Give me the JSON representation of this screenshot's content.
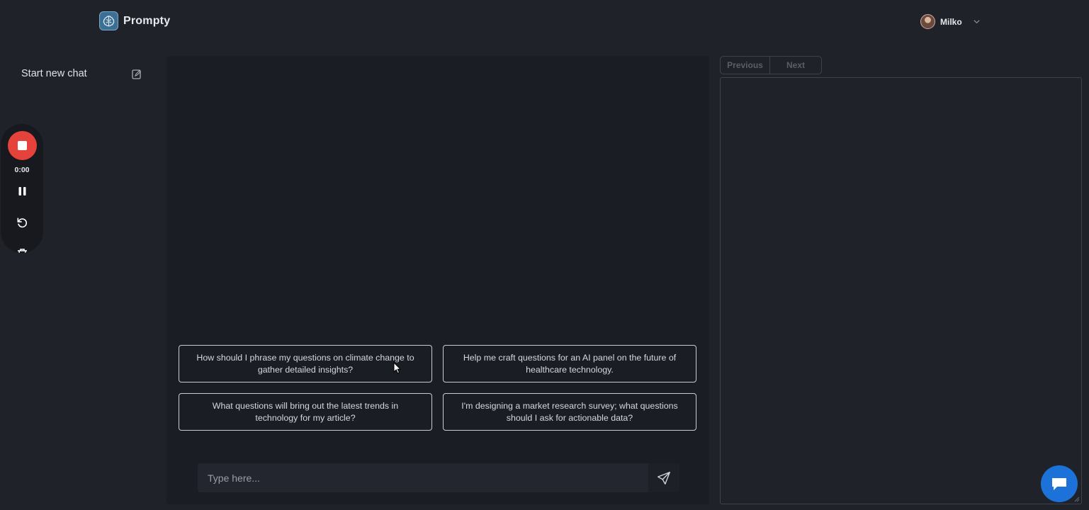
{
  "header": {
    "brand_name": "Prompty",
    "user_name": "Milko"
  },
  "sidebar": {
    "new_chat_label": "Start new chat"
  },
  "recorder": {
    "time": "0:00"
  },
  "chat": {
    "suggestions": [
      "How should I phrase my questions on climate change to gather detailed insights?",
      "Help me craft questions for an AI panel on the future of healthcare technology.",
      "What questions will bring out the latest trends in technology for my article?",
      "I'm designing a market research survey; what questions should I ask for actionable data?"
    ],
    "input_placeholder": "Type here...",
    "input_value": ""
  },
  "preview": {
    "previous_label": "Previous",
    "next_label": "Next"
  },
  "colors": {
    "background": "#1f2229",
    "panel": "#1b1d24",
    "record": "#e5423b",
    "support_bubble": "#1c72d8"
  },
  "icons": [
    "brain-logo-icon",
    "chevron-down-icon",
    "new-chat-icon",
    "stop-icon",
    "pause-icon",
    "restart-icon",
    "trash-icon",
    "send-icon",
    "chat-bubble-icon",
    "resize-grip-icon",
    "mouse-cursor-icon"
  ]
}
